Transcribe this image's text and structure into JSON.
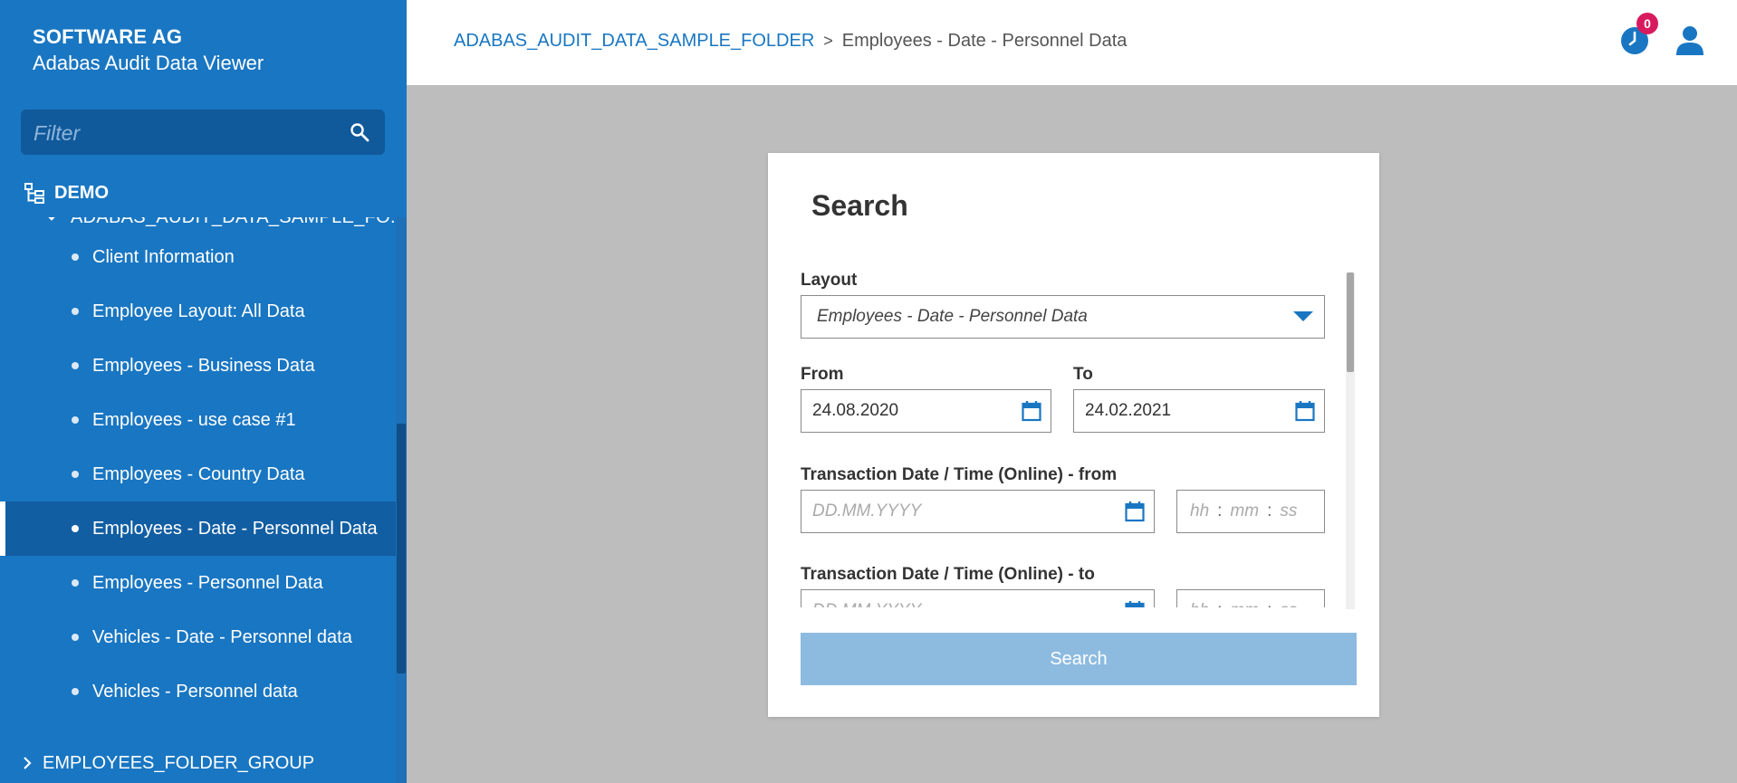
{
  "brand": {
    "company": "SOFTWARE AG",
    "app": "Adabas Audit Data Viewer"
  },
  "filter": {
    "placeholder": "Filter",
    "value": ""
  },
  "tree": {
    "root": "DEMO",
    "open_folder": "ADABAS_AUDIT_DATA_SAMPLE_FO...",
    "items": [
      {
        "label": "Client Information"
      },
      {
        "label": "Employee Layout: All Data"
      },
      {
        "label": "Employees - Business Data"
      },
      {
        "label": "Employees - use case #1"
      },
      {
        "label": "Employees - Country Data"
      },
      {
        "label": "Employees - Date - Personnel Data"
      },
      {
        "label": "Employees - Personnel Data"
      },
      {
        "label": "Vehicles - Date - Personnel data"
      },
      {
        "label": "Vehicles - Personnel data"
      }
    ],
    "active_index": 5,
    "folder_group": "EMPLOYEES_FOLDER_GROUP"
  },
  "header": {
    "breadcrumb_folder": "ADABAS_AUDIT_DATA_SAMPLE_FOLDER",
    "breadcrumb_separator": ">",
    "breadcrumb_current": "Employees - Date - Personnel Data",
    "history_badge": "0"
  },
  "dialog": {
    "title": "Search",
    "layout_label": "Layout",
    "layout_value": "Employees - Date - Personnel Data",
    "from_label": "From",
    "from_value": "24.08.2020",
    "to_label": "To",
    "to_value": "24.02.2021",
    "tx_from_label": "Transaction Date / Time (Online) - from",
    "tx_to_label": "Transaction Date / Time (Online) - to",
    "date_placeholder": "DD.MM.YYYY",
    "time_hh": "hh",
    "time_mm": "mm",
    "time_ss": "ss",
    "time_sep": ":",
    "search_button": "Search"
  },
  "colors": {
    "sidebar": "#1976c2",
    "sidebar_active": "#115ea3",
    "filter_bg": "#10599a",
    "accent": "#1976c2",
    "badge": "#d81b60",
    "search_button": "#8dbbe0",
    "content_bg": "#bdbdbd"
  },
  "icons": [
    "search-icon",
    "tree-icon",
    "chevron-down-icon",
    "chevron-right-icon",
    "history-clock-icon",
    "user-icon",
    "calendar-icon",
    "dropdown-arrow-icon"
  ]
}
